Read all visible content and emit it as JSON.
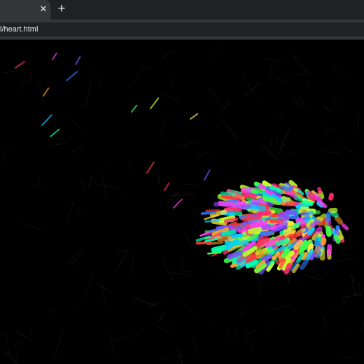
{
  "tab": {
    "close_icon": "close-icon",
    "new_tab_icon": "plus-icon"
  },
  "address_bar": {
    "url": "l/heart.html"
  },
  "page": {
    "background": "#000000",
    "particle_colors": [
      "#ff2a6d",
      "#ff3df0",
      "#7b4dff",
      "#2f7bff",
      "#00d0ff",
      "#00ffb0",
      "#3dff4a",
      "#c6ff2a",
      "#ffe53d",
      "#ff9a2a",
      "#ff3b3b"
    ]
  }
}
